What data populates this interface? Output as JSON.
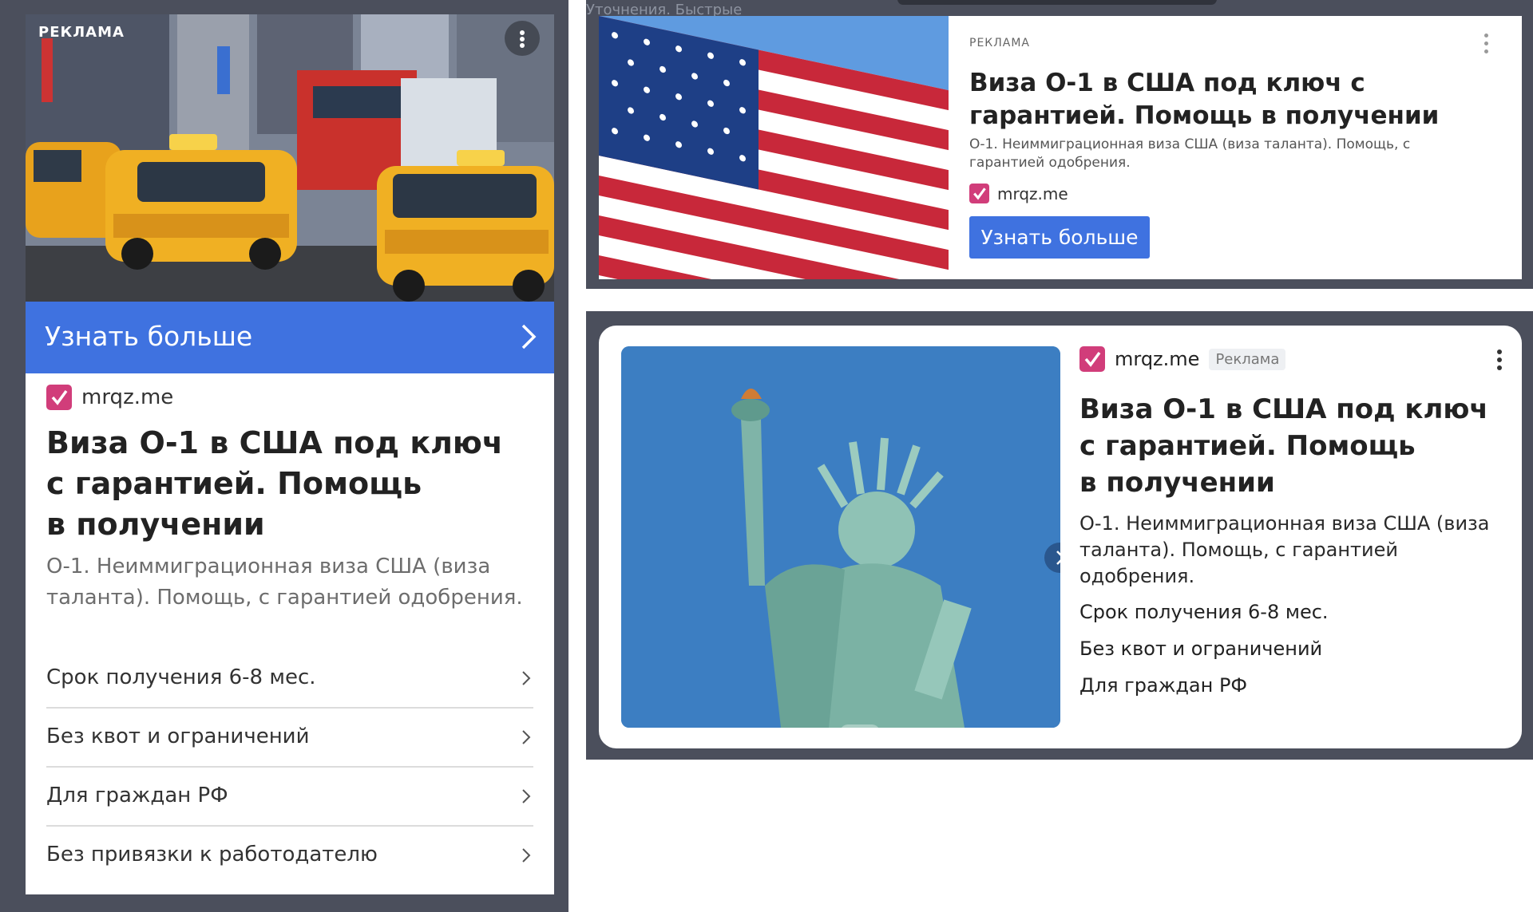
{
  "ad_label_caps": "РЕКЛАМА",
  "domain": "mrqz.me",
  "cta_label": "Узнать больше",
  "title": "Виза О-1 в США под ключ с гарантией. Помощь в получении",
  "title_lines": [
    "Виза О-1 в США под ключ",
    "с гарантией. Помощь",
    "в получении"
  ],
  "description": "О-1. Неиммиграционная виза США (виза таланта). Помощь, с гарантией одобрения.",
  "features": [
    "Срок получения 6-8 мес.",
    "Без квот и ограничений",
    "Для граждан РФ",
    "Без привязки к работодателю"
  ],
  "ad_badge": "Реклама",
  "background_ghost_text": {
    "top": "Уточнения. Быстрые"
  },
  "icons": {
    "menu": "more-vertical-icon",
    "next": "chevron-right-icon",
    "checkmark": "checkmark-icon"
  },
  "colors": {
    "accent_blue": "#3f72e0",
    "checkmark_pink": "#d13d7a",
    "frame_dark": "#4b4f5c"
  }
}
